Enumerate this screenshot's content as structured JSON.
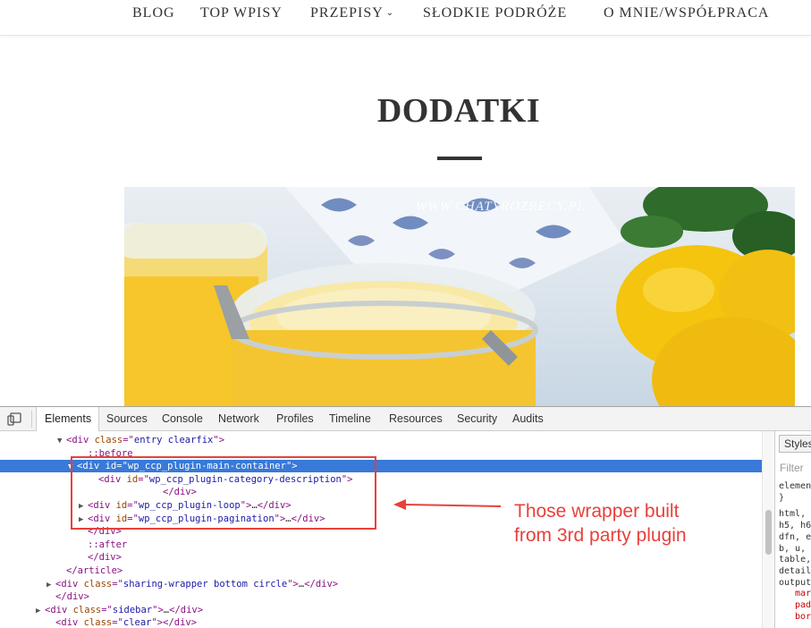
{
  "nav": {
    "items": [
      {
        "label": "BLOG"
      },
      {
        "label": "TOP WPISY"
      },
      {
        "label": "PRZEPISY",
        "has_dropdown": true
      },
      {
        "label": "SŁODKIE PODRÓŻE"
      },
      {
        "label": "O MNIE/WSPÓŁPRACA"
      }
    ]
  },
  "page": {
    "title": "DODATKI",
    "hero_watermark": "WWW.CHATYROZRECY.PL"
  },
  "devtools": {
    "tabs": [
      "Elements",
      "Sources",
      "Console",
      "Network",
      "Profiles",
      "Timeline",
      "Resources",
      "Security",
      "Audits"
    ],
    "active_tab": "Elements",
    "dom_lines": [
      {
        "indent": 6,
        "tri": "▼",
        "parts": [
          [
            "tag",
            "<div "
          ],
          [
            "attr",
            "class"
          ],
          [
            "tag",
            "=\""
          ],
          [
            "val",
            "entry clearfix"
          ],
          [
            "tag",
            "\">"
          ]
        ]
      },
      {
        "indent": 8,
        "tri": "",
        "parts": [
          [
            "pseudo",
            "::before"
          ]
        ]
      },
      {
        "indent": 7,
        "tri": "▼",
        "selected": true,
        "parts": [
          [
            "tag",
            "<div "
          ],
          [
            "attr",
            "id"
          ],
          [
            "tag",
            "=\""
          ],
          [
            "val",
            "wp_ccp_plugin-main-container"
          ],
          [
            "tag",
            "\">"
          ]
        ]
      },
      {
        "indent": 9,
        "tri": "",
        "parts": [
          [
            "tag",
            "<div "
          ],
          [
            "attr",
            "id"
          ],
          [
            "tag",
            "=\""
          ],
          [
            "val",
            "wp_ccp_plugin-category-description"
          ],
          [
            "tag",
            "\">"
          ]
        ]
      },
      {
        "indent": 15,
        "tri": "",
        "parts": [
          [
            "tag",
            "</div>"
          ]
        ]
      },
      {
        "indent": 8,
        "tri": "▶",
        "parts": [
          [
            "tag",
            "<div "
          ],
          [
            "attr",
            "id"
          ],
          [
            "tag",
            "=\""
          ],
          [
            "val",
            "wp_ccp_plugin-loop"
          ],
          [
            "tag",
            "\">"
          ],
          [
            "ellipsis",
            "…"
          ],
          [
            "tag",
            "</div>"
          ]
        ]
      },
      {
        "indent": 8,
        "tri": "▶",
        "parts": [
          [
            "tag",
            "<div "
          ],
          [
            "attr",
            "id"
          ],
          [
            "tag",
            "=\""
          ],
          [
            "val",
            "wp_ccp_plugin-pagination"
          ],
          [
            "tag",
            "\">"
          ],
          [
            "ellipsis",
            "…"
          ],
          [
            "tag",
            "</div>"
          ]
        ]
      },
      {
        "indent": 8,
        "tri": "",
        "parts": [
          [
            "tag",
            "</div>"
          ]
        ]
      },
      {
        "indent": 8,
        "tri": "",
        "parts": [
          [
            "pseudo",
            "::after"
          ]
        ]
      },
      {
        "indent": 8,
        "tri": "",
        "parts": [
          [
            "tag",
            "</div>"
          ]
        ]
      },
      {
        "indent": 6,
        "tri": "",
        "parts": [
          [
            "tag",
            "</article>"
          ]
        ]
      },
      {
        "indent": 5,
        "tri": "▶",
        "parts": [
          [
            "tag",
            "<div "
          ],
          [
            "attr",
            "class"
          ],
          [
            "tag",
            "=\""
          ],
          [
            "val",
            "sharing-wrapper bottom circle"
          ],
          [
            "tag",
            "\">"
          ],
          [
            "ellipsis",
            "…"
          ],
          [
            "tag",
            "</div>"
          ]
        ]
      },
      {
        "indent": 5,
        "tri": "",
        "parts": [
          [
            "tag",
            "</div>"
          ]
        ]
      },
      {
        "indent": 4,
        "tri": "▶",
        "parts": [
          [
            "tag",
            "<div "
          ],
          [
            "attr",
            "class"
          ],
          [
            "tag",
            "=\""
          ],
          [
            "val",
            "sidebar"
          ],
          [
            "tag",
            "\">"
          ],
          [
            "ellipsis",
            "…"
          ],
          [
            "tag",
            "</div>"
          ]
        ]
      },
      {
        "indent": 5,
        "tri": "",
        "parts": [
          [
            "tag",
            "<div "
          ],
          [
            "attr",
            "class"
          ],
          [
            "tag",
            "=\""
          ],
          [
            "val",
            "clear"
          ],
          [
            "tag",
            "\"></div>"
          ]
        ]
      }
    ],
    "styles": {
      "tab_label": "Styles",
      "filter_placeholder": "Filter",
      "lines": [
        {
          "text": "elemen",
          "type": "plain"
        },
        {
          "text": "}",
          "type": "plain"
        },
        {
          "text": "html, ",
          "type": "plain"
        },
        {
          "text": "h5, h6",
          "type": "plain"
        },
        {
          "text": "dfn, e",
          "type": "plain"
        },
        {
          "text": "b, u, ",
          "type": "plain"
        },
        {
          "text": "table,",
          "type": "plain"
        },
        {
          "text": "detail",
          "type": "plain"
        },
        {
          "text": "output",
          "type": "plain"
        },
        {
          "text": "mar",
          "type": "prop"
        },
        {
          "text": "pad",
          "type": "prop"
        },
        {
          "text": "bor",
          "type": "prop"
        }
      ]
    }
  },
  "annotation": {
    "line1": "Those wrapper built",
    "line2": "from 3rd party plugin",
    "color": "#e8413b"
  }
}
